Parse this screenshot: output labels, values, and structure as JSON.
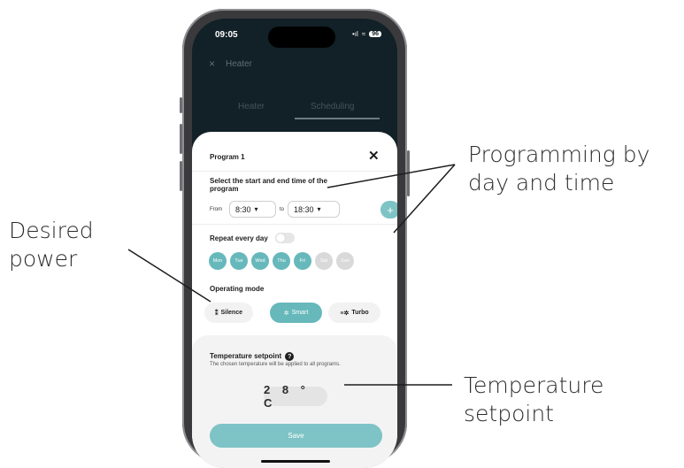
{
  "callouts": {
    "programming": "Programming by day and time",
    "power": "Desired power",
    "temperature": "Temperature setpoint"
  },
  "status_bar": {
    "time": "09:05",
    "signal": "•ıl",
    "wifi": "≈",
    "battery": "96"
  },
  "header": {
    "close_icon": "×",
    "title": "Heater"
  },
  "tabs": [
    {
      "label": "Heater"
    },
    {
      "label": "Scheduling"
    }
  ],
  "sheet": {
    "title": "Program 1",
    "close_icon": "✕",
    "instruction": "Select the start and end time of the program",
    "from_label": "From",
    "from_time": "8:30",
    "to_label": "to",
    "to_time": "18:30",
    "add_label": "+",
    "repeat_label": "Repeat every day",
    "repeat_enabled": false,
    "days": [
      {
        "label": "Mon",
        "selected": true
      },
      {
        "label": "Tue",
        "selected": true
      },
      {
        "label": "Wed",
        "selected": true
      },
      {
        "label": "Thu",
        "selected": true
      },
      {
        "label": "Fri",
        "selected": true
      },
      {
        "label": "Sat",
        "selected": false
      },
      {
        "label": "Sun",
        "selected": false
      }
    ],
    "operating_mode_label": "Operating mode",
    "modes": [
      {
        "label": "Silence",
        "icon": "silence-icon",
        "selected": false
      },
      {
        "label": "Smart",
        "icon": "smart-icon",
        "selected": true
      },
      {
        "label": "Turbo",
        "icon": "turbo-icon",
        "selected": false
      }
    ],
    "temperature": {
      "title": "Temperature setpoint",
      "help_icon": "?",
      "note": "The chosen temperature will be applied to all programs.",
      "value": "2 8 ° C"
    },
    "save_label": "Save"
  },
  "colors": {
    "accent": "#67b8bb",
    "accent_light": "#7ec3c5",
    "app_background": "#122027"
  }
}
